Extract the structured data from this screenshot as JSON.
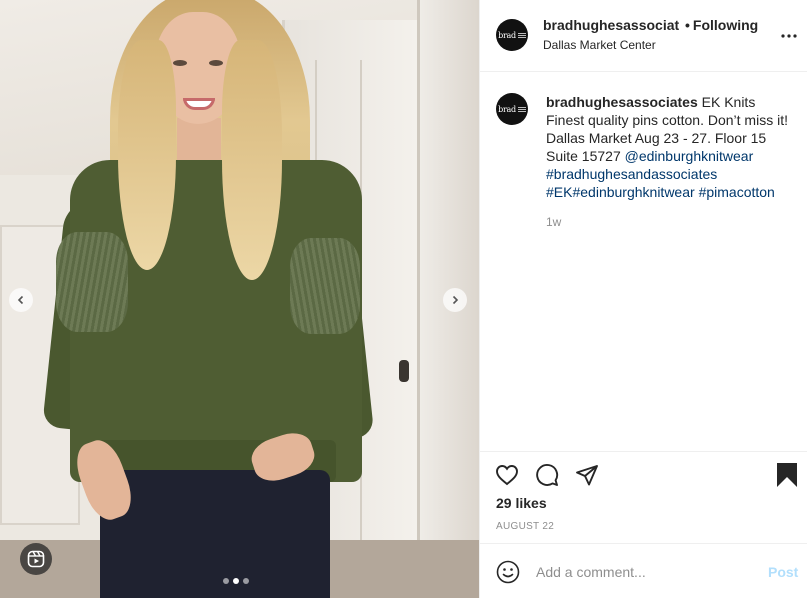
{
  "post": {
    "username": "bradhughesassociates",
    "header_username_visible": "bradhughesassociat",
    "separator": "•",
    "follow_status": "Following",
    "location": "Dallas Market Center",
    "avatar_text": "brad",
    "caption": {
      "username": "bradhughesassociates",
      "text": "EK Knits Finest quality pins cotton. Don’t miss it! Dallas Market Aug 23 - 27. Floor 15 Suite 15727",
      "mention": "@edinburghknitwear",
      "hashtags": [
        "#bradhughesandassociates",
        "#EK",
        "#edinburghknitwear",
        "#pimacotton"
      ]
    },
    "time_ago": "1w",
    "likes": "29 likes",
    "date": "AUGUST 22"
  },
  "media": {
    "slide_count": 3,
    "active_slide": 2,
    "icons": [
      "chevron-left-icon",
      "chevron-right-icon",
      "reels-icon"
    ]
  },
  "comment": {
    "placeholder": "Add a comment...",
    "post_label": "Post"
  },
  "icons": [
    "more-icon",
    "heart-icon",
    "comment-icon",
    "share-icon",
    "bookmark-icon",
    "emoji-icon"
  ],
  "colors": {
    "link": "#00376b",
    "post_button_disabled": "#b2dffc",
    "secondary_text": "#8e8e8e",
    "border": "#efefef"
  }
}
